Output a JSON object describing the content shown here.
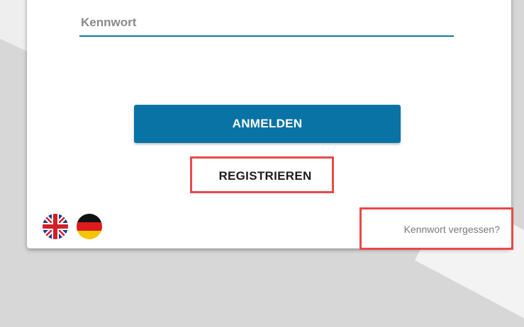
{
  "form": {
    "password_label": "Kennwort",
    "login_button": "ANMELDEN",
    "register_button": "REGISTRIEREN",
    "forgot_password_link": "Kennwort vergessen?"
  },
  "languages": [
    {
      "name": "English",
      "icon": "uk-flag-icon"
    },
    {
      "name": "Deutsch",
      "icon": "german-flag-icon"
    }
  ],
  "colors": {
    "accent": "#0a73a6",
    "highlight": "#e84a4a",
    "background": "#d7d7d7"
  }
}
